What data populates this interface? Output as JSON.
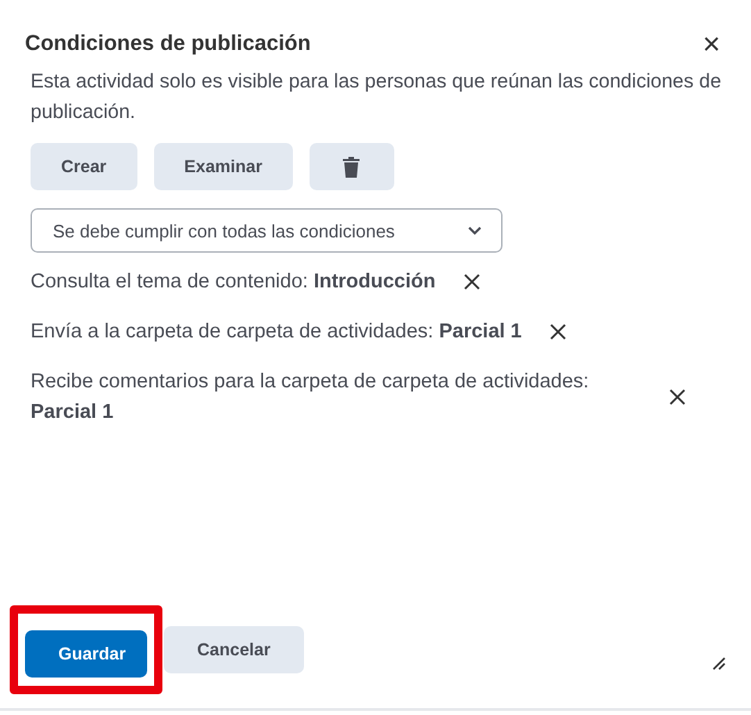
{
  "dialog": {
    "title": "Condiciones de publicación",
    "close": "×"
  },
  "description": "Esta actividad solo es visible para las personas que reúnan las condiciones de publicación.",
  "actions": [
    {
      "kind": "text",
      "label": "Crear"
    },
    {
      "kind": "text",
      "label": "Examinar"
    },
    {
      "kind": "delete"
    }
  ],
  "select": {
    "value": "Se debe cumplir con todas las condiciones"
  },
  "conditions": [
    {
      "text": "Consulta el tema de contenido: **Introducción**"
    },
    {
      "text": "Envía a la carpeta de carpeta de actividades: **Parcial 1**"
    },
    {
      "text": "Recibe comentarios para la carpeta de carpeta de actividades: **Parcial 1**"
    }
  ],
  "footer": [
    {
      "label": "Guardar",
      "primary": true,
      "highlighted": true
    },
    {
      "label": "Cancelar",
      "primary": false,
      "highlighted": false
    }
  ]
}
